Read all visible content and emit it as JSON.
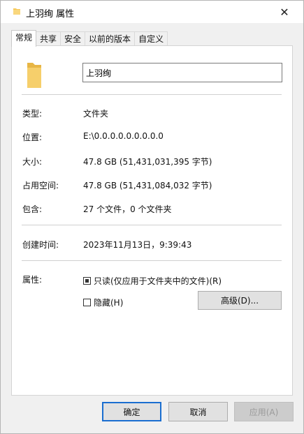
{
  "window": {
    "title": "上羽绚 属性",
    "close_label": "✕"
  },
  "tabs": [
    {
      "label": "常规",
      "active": true
    },
    {
      "label": "共享"
    },
    {
      "label": "安全"
    },
    {
      "label": "以前的版本"
    },
    {
      "label": "自定义"
    }
  ],
  "general": {
    "folder_name": "上羽绚",
    "type_label": "类型:",
    "type_value": "文件夹",
    "location_label": "位置:",
    "location_value": "E:\\0.0.0.0.0.0.0.0.0",
    "size_label": "大小:",
    "size_value": "47.8 GB (51,431,031,395 字节)",
    "size_on_disk_label": "占用空间:",
    "size_on_disk_value": "47.8 GB (51,431,084,032 字节)",
    "contains_label": "包含:",
    "contains_value": "27 个文件，0 个文件夹",
    "created_label": "创建时间:",
    "created_value": "2023年11月13日，9:39:43",
    "attributes_label": "属性:",
    "readonly_label": "只读(仅应用于文件夹中的文件)(R)",
    "readonly_checked": true,
    "hidden_label": "隐藏(H)",
    "hidden_checked": false,
    "advanced_label": "高级(D)..."
  },
  "buttons": {
    "ok": "确定",
    "cancel": "取消",
    "apply": "应用(A)"
  },
  "colors": {
    "folder": "#f6c85a",
    "default_button_border": "#1a6ed0"
  }
}
